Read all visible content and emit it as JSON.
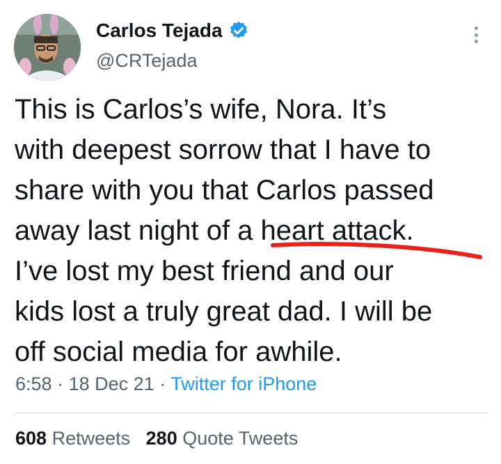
{
  "author": {
    "name": "Carlos Tejada",
    "handle": "@CRTejada"
  },
  "tweet": {
    "text": "This is Carlos’s wife, Nora. It’s\nwith deepest sorrow that I have to\nshare with you that Carlos passed\naway last night of a heart attack.\nI’ve lost my best friend and our\nkids lost a truly great dad. I will be\noff social media for awhile.",
    "time": "6:58",
    "date": "18 Dec 21",
    "source": "Twitter for iPhone",
    "separator": "·"
  },
  "stats": {
    "retweets_count": "608",
    "retweets_label": "Retweets",
    "quotes_count": "280",
    "quotes_label": "Quote Tweets"
  },
  "colors": {
    "link": "#1d9bf0",
    "secondary_text": "#536471",
    "annotation": "#e8211a",
    "verified": "#1d9bf0"
  },
  "icons": {
    "verified": "verified-badge-icon",
    "more": "more-options-icon"
  }
}
